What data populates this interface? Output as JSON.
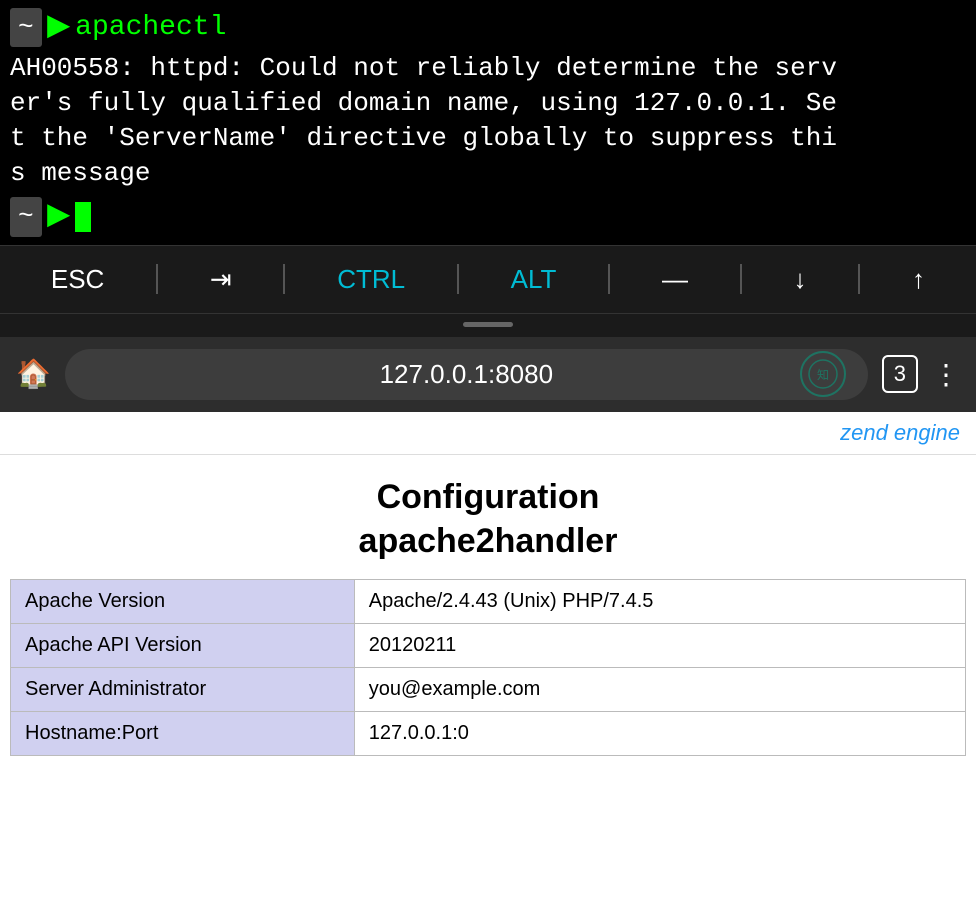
{
  "terminal": {
    "prompt": {
      "tilde": "~",
      "command": "apachectl"
    },
    "output": "AH00558: httpd: Could not reliably determine the serv\ner's fully qualified domain name, using 127.0.0.1. Se\nt the 'ServerName' directive globally to suppress thi\ns message",
    "cursor_tilde": "~"
  },
  "keyboard": {
    "esc_label": "ESC",
    "tab_label": "⇥",
    "ctrl_label": "CTRL",
    "alt_label": "ALT",
    "dash_label": "—",
    "down_label": "↓",
    "up_label": "↑"
  },
  "browser": {
    "address": "127.0.0.1:8080",
    "tab_count": "3",
    "home_icon": "⌂"
  },
  "web": {
    "zend_text": "zend engine",
    "title_line1": "Configuration",
    "title_line2": "apache2handler",
    "table_rows": [
      {
        "label": "Apache Version",
        "value": "Apache/2.4.43 (Unix) PHP/7.4.5"
      },
      {
        "label": "Apache API Version",
        "value": "20120211"
      },
      {
        "label": "Server Administrator",
        "value": "you@example.com"
      },
      {
        "label": "Hostname:Port",
        "value": "127.0.0.1:0"
      }
    ]
  }
}
